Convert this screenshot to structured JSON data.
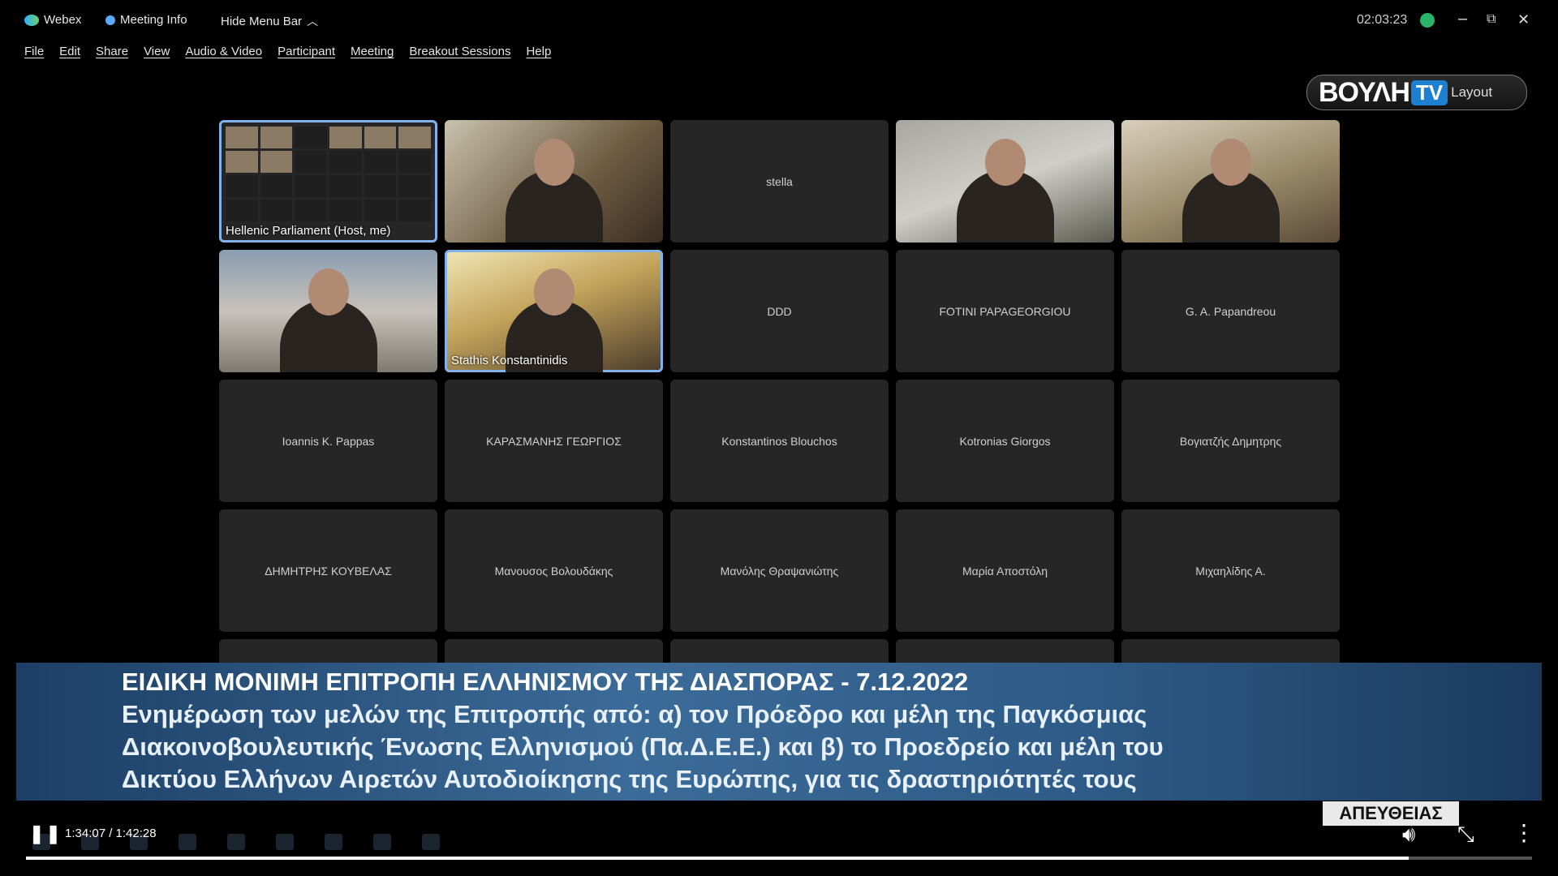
{
  "titlebar": {
    "app_name": "Webex",
    "meeting_info": "Meeting Info",
    "hide_menu": "Hide Menu Bar",
    "timer": "02:03:23",
    "minimize": "–",
    "restore": "⧉",
    "close": "✕"
  },
  "menu": [
    "File",
    "Edit",
    "Share",
    "View",
    "Audio & Video",
    "Participant",
    "Meeting",
    "Breakout Sessions",
    "Help"
  ],
  "logo": {
    "brand": "ΒΟΥΛΗ",
    "tv": "TV",
    "layout": "Layout"
  },
  "participants": [
    {
      "name": "Hellenic Parliament (Host, me)",
      "video": true
    },
    {
      "name": "",
      "video": true
    },
    {
      "name": "stella",
      "video": false
    },
    {
      "name": "",
      "video": true
    },
    {
      "name": "",
      "video": true
    },
    {
      "name": "",
      "video": true
    },
    {
      "name": "Stathis Konstantinidis",
      "video": true
    },
    {
      "name": "DDD",
      "video": false
    },
    {
      "name": "FOTINI PAPAGEORGIOU",
      "video": false
    },
    {
      "name": "G. A. Papandreou",
      "video": false
    },
    {
      "name": "Ioannis K. Pappas",
      "video": false
    },
    {
      "name": "ΚΑΡΑΣΜΑΝΗΣ ΓΕΩΡΓΙΟΣ",
      "video": false
    },
    {
      "name": "Konstantinos Blouchos",
      "video": false
    },
    {
      "name": "Kotronias Giorgos",
      "video": false
    },
    {
      "name": "Βογιατζής Δημητρης",
      "video": false
    },
    {
      "name": "ΔΗΜΗΤΡΗΣ ΚΟΥΒΕΛΑΣ",
      "video": false
    },
    {
      "name": "Μανουσος Βολουδάκης",
      "video": false
    },
    {
      "name": "Μανόλης Θραψανιώτης",
      "video": false
    },
    {
      "name": "Μαρία Αποστόλη",
      "video": false
    },
    {
      "name": "Μιχαηλίδης Α.",
      "video": false
    }
  ],
  "banner": {
    "line1": "ΕΙΔΙΚΗ ΜΟΝΙΜΗ ΕΠΙΤΡΟΠΗ ΕΛΛΗΝΙΣΜΟΥ ΤΗΣ ΔΙΑΣΠΟΡΑΣ - 7.12.2022",
    "line2": "Ενημέρωση των μελών της Επιτροπής από: α) τον Πρόεδρο και μέλη της Παγκόσμιας",
    "line3": "Διακοινοβουλευτικής Ένωσης Ελληνισμού (Πα.Δ.Ε.Ε.) και β) το Προεδρείο και μέλη του",
    "line4": "Δικτύου Ελλήνων Αιρετών Αυτοδιοίκησης της Ευρώπης, για τις δραστηριότητές τους"
  },
  "live_badge": "ΑΠΕΥΘΕΙΑΣ",
  "player": {
    "time": "1:34:07 / 1:42:28",
    "progress_fraction": 0.918
  }
}
